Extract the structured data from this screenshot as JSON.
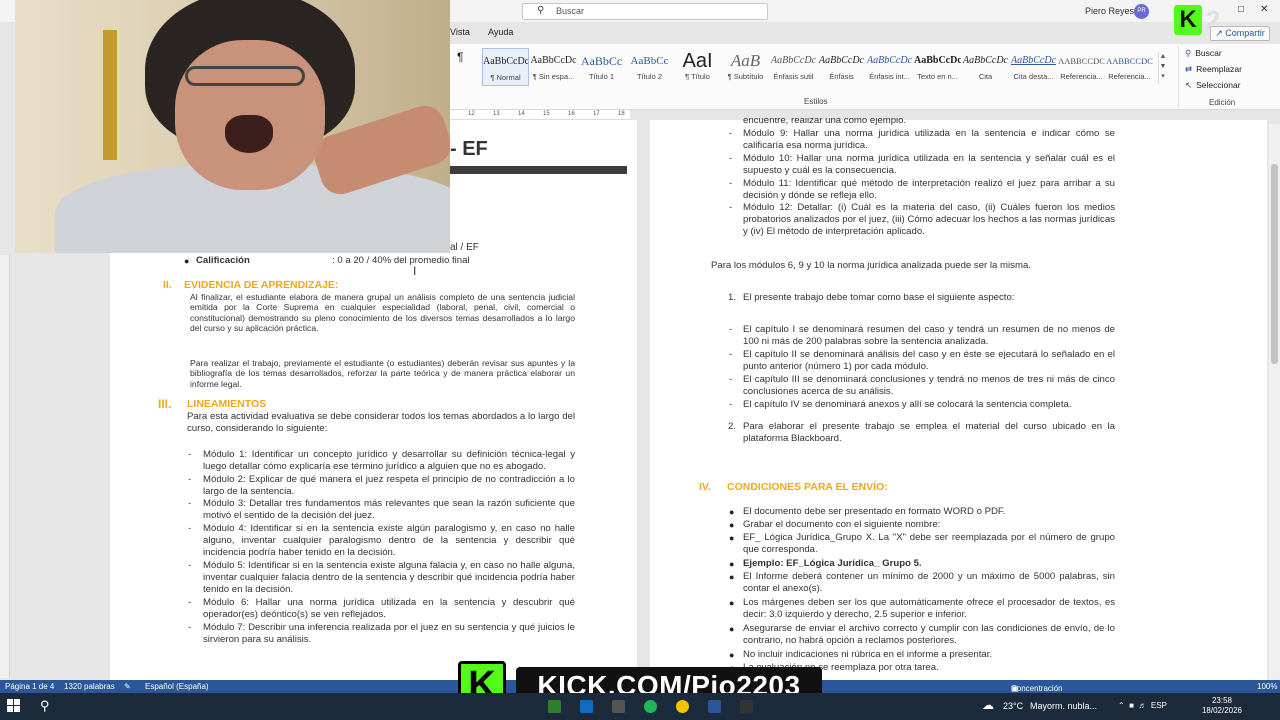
{
  "titlebar": {
    "search_placeholder": "Buscar",
    "user_name": "Piero Reyes",
    "user_initials": "PR"
  },
  "ribbon": {
    "tabs": [
      "Vista",
      "Ayuda"
    ],
    "share_label": "Compartir",
    "styles": [
      {
        "preview": "AaBbCcDc",
        "name": "¶ Normal"
      },
      {
        "preview": "AaBbCcDc",
        "name": "¶ Sin espa..."
      },
      {
        "preview": "AaBbCc",
        "name": "Título 1"
      },
      {
        "preview": "AaBbCc",
        "name": "Título 2"
      },
      {
        "preview": "AaI",
        "name": "¶ Título"
      },
      {
        "preview": "AaB",
        "name": "¶ Subtítulo"
      },
      {
        "preview": "AaBbCcDc",
        "name": "Énfasis sutil"
      },
      {
        "preview": "AaBbCcDc",
        "name": "Énfasis"
      },
      {
        "preview": "AaBbCcDc",
        "name": "Énfasis int..."
      },
      {
        "preview": "AaBbCcDc",
        "name": "Texto en n..."
      },
      {
        "preview": "AaBbCcDc",
        "name": "Cita"
      },
      {
        "preview": "AaBbCcDc",
        "name": "Cita desta..."
      },
      {
        "preview": "AABBCCDC",
        "name": "Referencia..."
      },
      {
        "preview": "AABBCCDC",
        "name": "Referencia..."
      }
    ],
    "styles_group_label": "Estilos",
    "editing": {
      "find": "Buscar",
      "replace": "Reemplazar",
      "select": "Seleccionar",
      "group_label": "Edición"
    }
  },
  "ruler": {
    "marks": [
      "12",
      "13",
      "14",
      "15",
      "16",
      "17",
      "18"
    ]
  },
  "left_page": {
    "title_fragment": "- EF",
    "ef_fragment": "al / EF",
    "grading_label": "Calificación",
    "grading_value": ": 0 a 20 / 40% del promedio final",
    "section2_num": "II.",
    "section2_title": "EVIDENCIA DE APRENDIZAJE:",
    "section2_p1": "Al finalizar, el estudiante elabora de manera grupal un análisis completo de una sentencia judicial emitida por la Corte Suprema en cualquier especialidad (laboral, penal, civil, comercial o constitucional) demostrando su pleno conocimiento de los diversos temas desarrollados a lo largo del curso y su aplicación práctica.",
    "section2_p2": "Para realizar el trabajo, previamente el estudiante (o estudiantes) deberán revisar sus apuntes y la bibliografía de los temas desarrollados, reforzar la parte teórica y de manera práctica elaborar un informe legal.",
    "section3_num": "III.",
    "section3_title": "LINEAMIENTOS",
    "section3_intro": "Para esta actividad evaluativa se debe considerar todos los temas abordados a lo largo del curso, considerando lo siguiente:",
    "modules": [
      "Módulo 1: Identificar un concepto jurídico y desarrollar su definición técnica-legal y luego detallar cómo explicaría ese término jurídico a alguien que no es abogado.",
      "Módulo 2: Explicar de qué manera el juez respeta el principio de no contradicción a lo largo de la sentencia.",
      "Módulo 3: Detallar tres fundamentos más relevantes que sean la razón suficiente que motivó el sentido de la decisión del juez.",
      "Módulo 4: Identificar si en la sentencia existe algún paralogismo y, en caso no halle alguno, inventar cualquier paralogismo dentro de la sentencia y describir qué incidencia podría haber tenido en la decisión.",
      "Módulo 5: Identificar si en la sentencia existe alguna falacia y, en caso no halle alguna, inventar cualquier falacia dentro de la sentencia y describir qué incidencia podría haber tenido en la decisión.",
      "Módulo 6: Hallar una norma jurídica utilizada en la sentencia y descubrir qué operador(es) deóntico(s) se ven reflejados.",
      "Módulo 7: Describir una inferencia realizada por el juez en su sentencia y qué juicios le sirvieron para su análisis."
    ]
  },
  "right_page": {
    "top_cut": "encuentre, realizar una como ejemplo.",
    "modules": [
      "Módulo 9: Hallar una norma jurídica utilizada en la sentencia e indicar cómo se calificaría esa norma jurídica.",
      "Módulo 10: Hallar una norma jurídica utilizada en la sentencia y señalar cuál es el supuesto y cuál es la consecuencia.",
      "Módulo 11: Identificar qué método de interpretación realizó el juez para arribar a su decisión y dónde se refleja ello.",
      "Módulo 12: Detallar: (i) Cuál es la materia del caso, (ii) Cuáles fueron los medios probatorios analizados por el juez, (iii) Cómo adecuar los hechos a las normas jurídicas y (iv) El método de interpretación aplicado."
    ],
    "note": "Para los módulos 6, 9 y 10 la norma jurídica analizada puede ser la misma.",
    "item1_num": "1.",
    "item1_text": "El presente trabajo debe tomar como base el siguiente aspecto:",
    "chapters": [
      "El capítulo I se denominará resumen del caso y tendrá un resumen de no menos de 100 ni más de 200 palabras sobre la sentencia analizada.",
      "El capítulo II se denominará análisis del caso y en éste se ejecutará lo señalado en el punto anterior (número 1) por cada módulo.",
      "El capítulo III se denominará conclusiones y tendrá no menos de tres ni más de cinco conclusiones acerca de su análisis.",
      "El capítulo IV se denominará anexos y allí se colocará la sentencia completa."
    ],
    "item2_num": "2.",
    "item2_text": "Para elaborar el presente trabajo se emplea el material del curso ubicado en la plataforma Blackboard.",
    "section4_num": "IV.",
    "section4_title": "CONDICIONES PARA EL ENVÍO:",
    "conditions": [
      "El documento debe ser presentado en formato WORD o PDF.",
      "Grabar el documento con el siguiente nombre:",
      "EF_ Lógica Jurídica_Grupo X. La \"X\" debe ser reemplazada por el número de grupo que corresponda.",
      "Ejemplo: EF_Lógica Jurídica_ Grupo 5.",
      "El Informe deberá contener un mínimo de 2000 y un máximo de 5000 palabras, sin contar el anexo(s).",
      "Los márgenes deben ser los que automáticamente ofrece el procesador de textos, es decir: 3.0 izquierdo y derecho, 2.5 superior e inferior.",
      "Asegurarse de enviar el archivo correcto y cumplir con las condiciones de envío, de lo contrario, no habrá opción a reclamos posteriores.",
      "No incluir indicaciones ni rúbrica en el informe a presentar.",
      "La evaluación no se reemplaza por otra tarea."
    ]
  },
  "statusbar": {
    "page": "Página 1 de 4",
    "words": "1320 palabras",
    "language": "Español (España)",
    "focus": "Concentración",
    "zoom": "100%"
  },
  "overlay": {
    "k2_letter": "K",
    "k2_number": "2",
    "kick_letter": "K",
    "kick_url": "KICK.COM/Pio2203"
  },
  "taskbar": {
    "temp": "23°C",
    "weather": "Mayorm. nubla...",
    "lang": "ESP",
    "time": "23:58",
    "date": "18/02/2026"
  },
  "colors": {
    "heading": "#f0a818",
    "word_blue": "#2b579a",
    "kick_green": "#53fc18"
  }
}
